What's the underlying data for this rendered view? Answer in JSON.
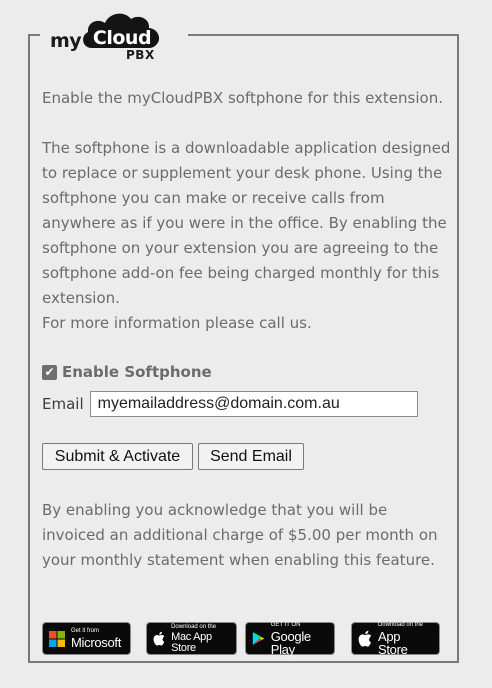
{
  "logo": {
    "part1": "my",
    "part2": "Cloud",
    "part3": "PBX"
  },
  "intro": "Enable the myCloudPBX softphone for this extension.",
  "description": "The softphone is a downloadable application designed to replace or supplement your desk phone. Using the softphone you can make or receive calls from anywhere as if you were in the office. By enabling the softphone on your extension you are agreeing to the softphone add-on fee being charged monthly for this extension.",
  "more_info": "For more information please call us.",
  "enable_softphone": {
    "label": "Enable Softphone",
    "checked": true
  },
  "email": {
    "label": "Email",
    "value": "myemailaddress@domain.com.au"
  },
  "buttons": {
    "submit": "Submit & Activate",
    "send_email": "Send Email"
  },
  "disclaimer": "By enabling you acknowledge that you will be invoiced an additional charge of $5.00 per month on your monthly statement when enabling this feature.",
  "store_badges": [
    {
      "small": "Get it from",
      "big": "Microsoft",
      "icon": "windows-icon"
    },
    {
      "small": "Download on the",
      "big": "Mac App Store",
      "icon": "apple-icon"
    },
    {
      "small": "GET IT ON",
      "big": "Google Play",
      "icon": "google-play-icon"
    },
    {
      "small": "Download on the",
      "big": "App Store",
      "icon": "apple-icon"
    }
  ],
  "colors": {
    "text": "#6b6b6b",
    "background": "#ececec",
    "border": "#7a7a7a",
    "badge": "#0a0a0a"
  }
}
